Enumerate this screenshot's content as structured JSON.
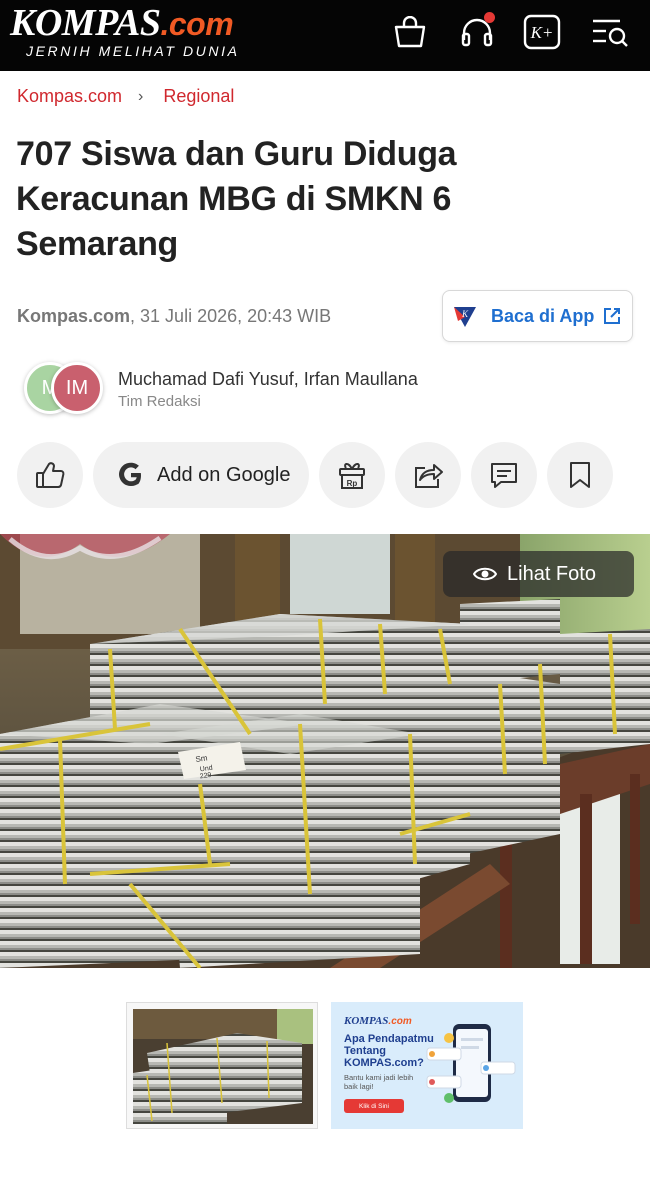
{
  "header": {
    "logo_main": "KOMPAS",
    "logo_suffix": ".com",
    "tagline": "JERNIH MELIHAT DUNIA",
    "icons": [
      "shopping-bag-icon",
      "headphones-icon",
      "kompas-plus-icon",
      "menu-search-icon"
    ],
    "kplus_label": "K+",
    "colors": {
      "background": "#050505",
      "accent": "#f15a24",
      "notification": "#e53935"
    }
  },
  "breadcrumb": {
    "items": [
      "Kompas.com",
      "Regional"
    ],
    "separator": "›",
    "color": "#d0282e"
  },
  "article": {
    "title": "707 Siswa dan Guru Diduga Keracunan MBG di SMKN 6 Semarang",
    "source": "Kompas.com",
    "datetime": ", 31 Juli 2026, 20:43 WIB"
  },
  "app_button": {
    "label": "Baca di App",
    "color": "#1f6fd0"
  },
  "authors": {
    "avatars": [
      "M",
      "IM"
    ],
    "names": "Muchamad Dafi Yusuf,  Irfan Maullana",
    "team": "Tim Redaksi"
  },
  "actions": {
    "like_icon": "thumbs-up-icon",
    "google_label": "Add on Google",
    "gift_label": "Rp",
    "share_icon": "share-icon",
    "comment_icon": "comment-icon",
    "bookmark_icon": "bookmark-icon"
  },
  "photo": {
    "view_label": "Lihat Foto",
    "note_text": "Sm\nUnd\n229"
  },
  "ad": {
    "brand_main": "KOMPAS",
    "brand_suffix": ".com",
    "question": "Apa Pendapatmu Tentang KOMPAS.com?",
    "subtext": "Bantu kami jadi lebih baik lagi!",
    "button": "Klik di Sini"
  }
}
